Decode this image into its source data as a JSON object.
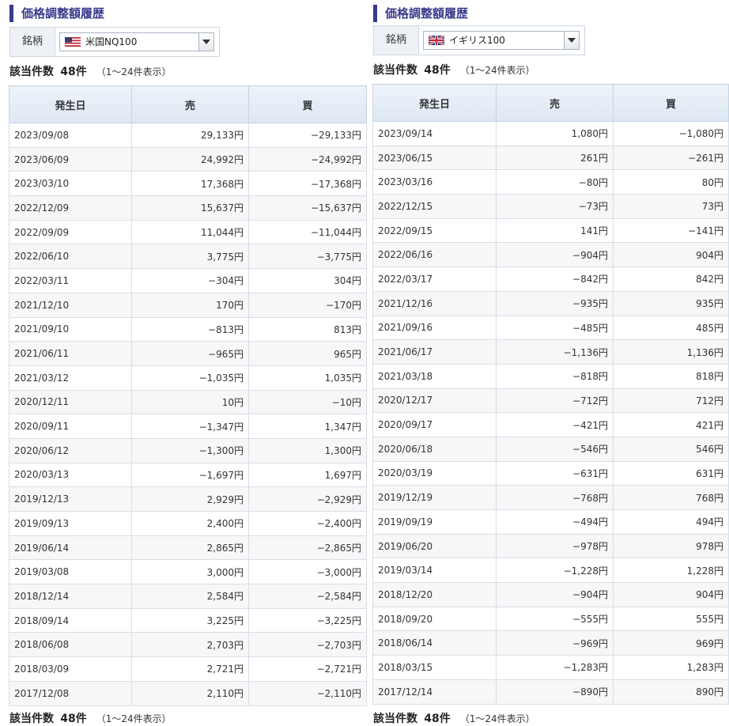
{
  "left": {
    "title": "価格調整額履歴",
    "symbol_label": "銘柄",
    "symbol": "米国NQ100",
    "flag_icon": "us-flag-icon",
    "count_label": "該当件数",
    "count_value": "48件",
    "count_range": "（1～24件表示）",
    "headers": [
      "発生日",
      "売",
      "買"
    ],
    "rows": [
      [
        "2023/09/08",
        "29,133円",
        "−29,133円"
      ],
      [
        "2023/06/09",
        "24,992円",
        "−24,992円"
      ],
      [
        "2023/03/10",
        "17,368円",
        "−17,368円"
      ],
      [
        "2022/12/09",
        "15,637円",
        "−15,637円"
      ],
      [
        "2022/09/09",
        "11,044円",
        "−11,044円"
      ],
      [
        "2022/06/10",
        "3,775円",
        "−3,775円"
      ],
      [
        "2022/03/11",
        "−304円",
        "304円"
      ],
      [
        "2021/12/10",
        "170円",
        "−170円"
      ],
      [
        "2021/09/10",
        "−813円",
        "813円"
      ],
      [
        "2021/06/11",
        "−965円",
        "965円"
      ],
      [
        "2021/03/12",
        "−1,035円",
        "1,035円"
      ],
      [
        "2020/12/11",
        "10円",
        "−10円"
      ],
      [
        "2020/09/11",
        "−1,347円",
        "1,347円"
      ],
      [
        "2020/06/12",
        "−1,300円",
        "1,300円"
      ],
      [
        "2020/03/13",
        "−1,697円",
        "1,697円"
      ],
      [
        "2019/12/13",
        "2,929円",
        "−2,929円"
      ],
      [
        "2019/09/13",
        "2,400円",
        "−2,400円"
      ],
      [
        "2019/06/14",
        "2,865円",
        "−2,865円"
      ],
      [
        "2019/03/08",
        "3,000円",
        "−3,000円"
      ],
      [
        "2018/12/14",
        "2,584円",
        "−2,584円"
      ],
      [
        "2018/09/14",
        "3,225円",
        "−3,225円"
      ],
      [
        "2018/06/08",
        "2,703円",
        "−2,703円"
      ],
      [
        "2018/03/09",
        "2,721円",
        "−2,721円"
      ],
      [
        "2017/12/08",
        "2,110円",
        "−2,110円"
      ]
    ]
  },
  "right": {
    "title": "価格調整額履歴",
    "symbol_label": "銘柄",
    "symbol": "イギリス100",
    "flag_icon": "uk-flag-icon",
    "count_label": "該当件数",
    "count_value": "48件",
    "count_range": "（1～24件表示）",
    "headers": [
      "発生日",
      "売",
      "買"
    ],
    "rows": [
      [
        "2023/09/14",
        "1,080円",
        "−1,080円"
      ],
      [
        "2023/06/15",
        "261円",
        "−261円"
      ],
      [
        "2023/03/16",
        "−80円",
        "80円"
      ],
      [
        "2022/12/15",
        "−73円",
        "73円"
      ],
      [
        "2022/09/15",
        "141円",
        "−141円"
      ],
      [
        "2022/06/16",
        "−904円",
        "904円"
      ],
      [
        "2022/03/17",
        "−842円",
        "842円"
      ],
      [
        "2021/12/16",
        "−935円",
        "935円"
      ],
      [
        "2021/09/16",
        "−485円",
        "485円"
      ],
      [
        "2021/06/17",
        "−1,136円",
        "1,136円"
      ],
      [
        "2021/03/18",
        "−818円",
        "818円"
      ],
      [
        "2020/12/17",
        "−712円",
        "712円"
      ],
      [
        "2020/09/17",
        "−421円",
        "421円"
      ],
      [
        "2020/06/18",
        "−546円",
        "546円"
      ],
      [
        "2020/03/19",
        "−631円",
        "631円"
      ],
      [
        "2019/12/19",
        "−768円",
        "768円"
      ],
      [
        "2019/09/19",
        "−494円",
        "494円"
      ],
      [
        "2019/06/20",
        "−978円",
        "978円"
      ],
      [
        "2019/03/14",
        "−1,228円",
        "1,228円"
      ],
      [
        "2018/12/20",
        "−904円",
        "904円"
      ],
      [
        "2018/09/20",
        "−555円",
        "555円"
      ],
      [
        "2018/06/14",
        "−969円",
        "969円"
      ],
      [
        "2018/03/15",
        "−1,283円",
        "1,283円"
      ],
      [
        "2017/12/14",
        "−890円",
        "890円"
      ]
    ]
  }
}
